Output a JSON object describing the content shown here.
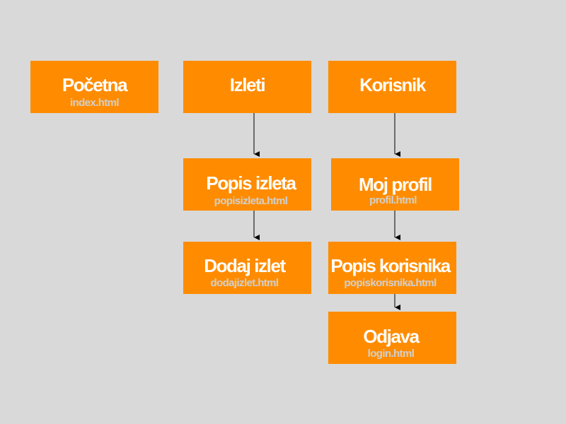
{
  "diagram": {
    "nodes": [
      {
        "id": "pocetna",
        "title": "Početna",
        "file": "index.html"
      },
      {
        "id": "izleti",
        "title": "Izleti",
        "file": ""
      },
      {
        "id": "korisnik",
        "title": "Korisnik",
        "file": ""
      },
      {
        "id": "popis-izleta",
        "title": "Popis izleta",
        "file": "popisizleta.html"
      },
      {
        "id": "moj-profil",
        "title": "Moj profil",
        "file": "profil.html"
      },
      {
        "id": "dodaj-izlet",
        "title": "Dodaj izlet",
        "file": "dodajizlet.html"
      },
      {
        "id": "popis-korisnika",
        "title": "Popis korisnika",
        "file": "popiskorisnika.html"
      },
      {
        "id": "odjava",
        "title": "Odjava",
        "file": "login.html"
      }
    ],
    "edges": [
      {
        "from": "izleti",
        "to": "popis-izleta"
      },
      {
        "from": "popis-izleta",
        "to": "dodaj-izlet"
      },
      {
        "from": "korisnik",
        "to": "moj-profil"
      },
      {
        "from": "moj-profil",
        "to": "popis-korisnika"
      },
      {
        "from": "popis-korisnika",
        "to": "odjava"
      }
    ],
    "colors": {
      "background": "#d9d9d9",
      "node_fill": "#ff8c00",
      "title_text": "#ffffff",
      "file_text": "#d0d0d0",
      "connector": "#000000"
    }
  }
}
